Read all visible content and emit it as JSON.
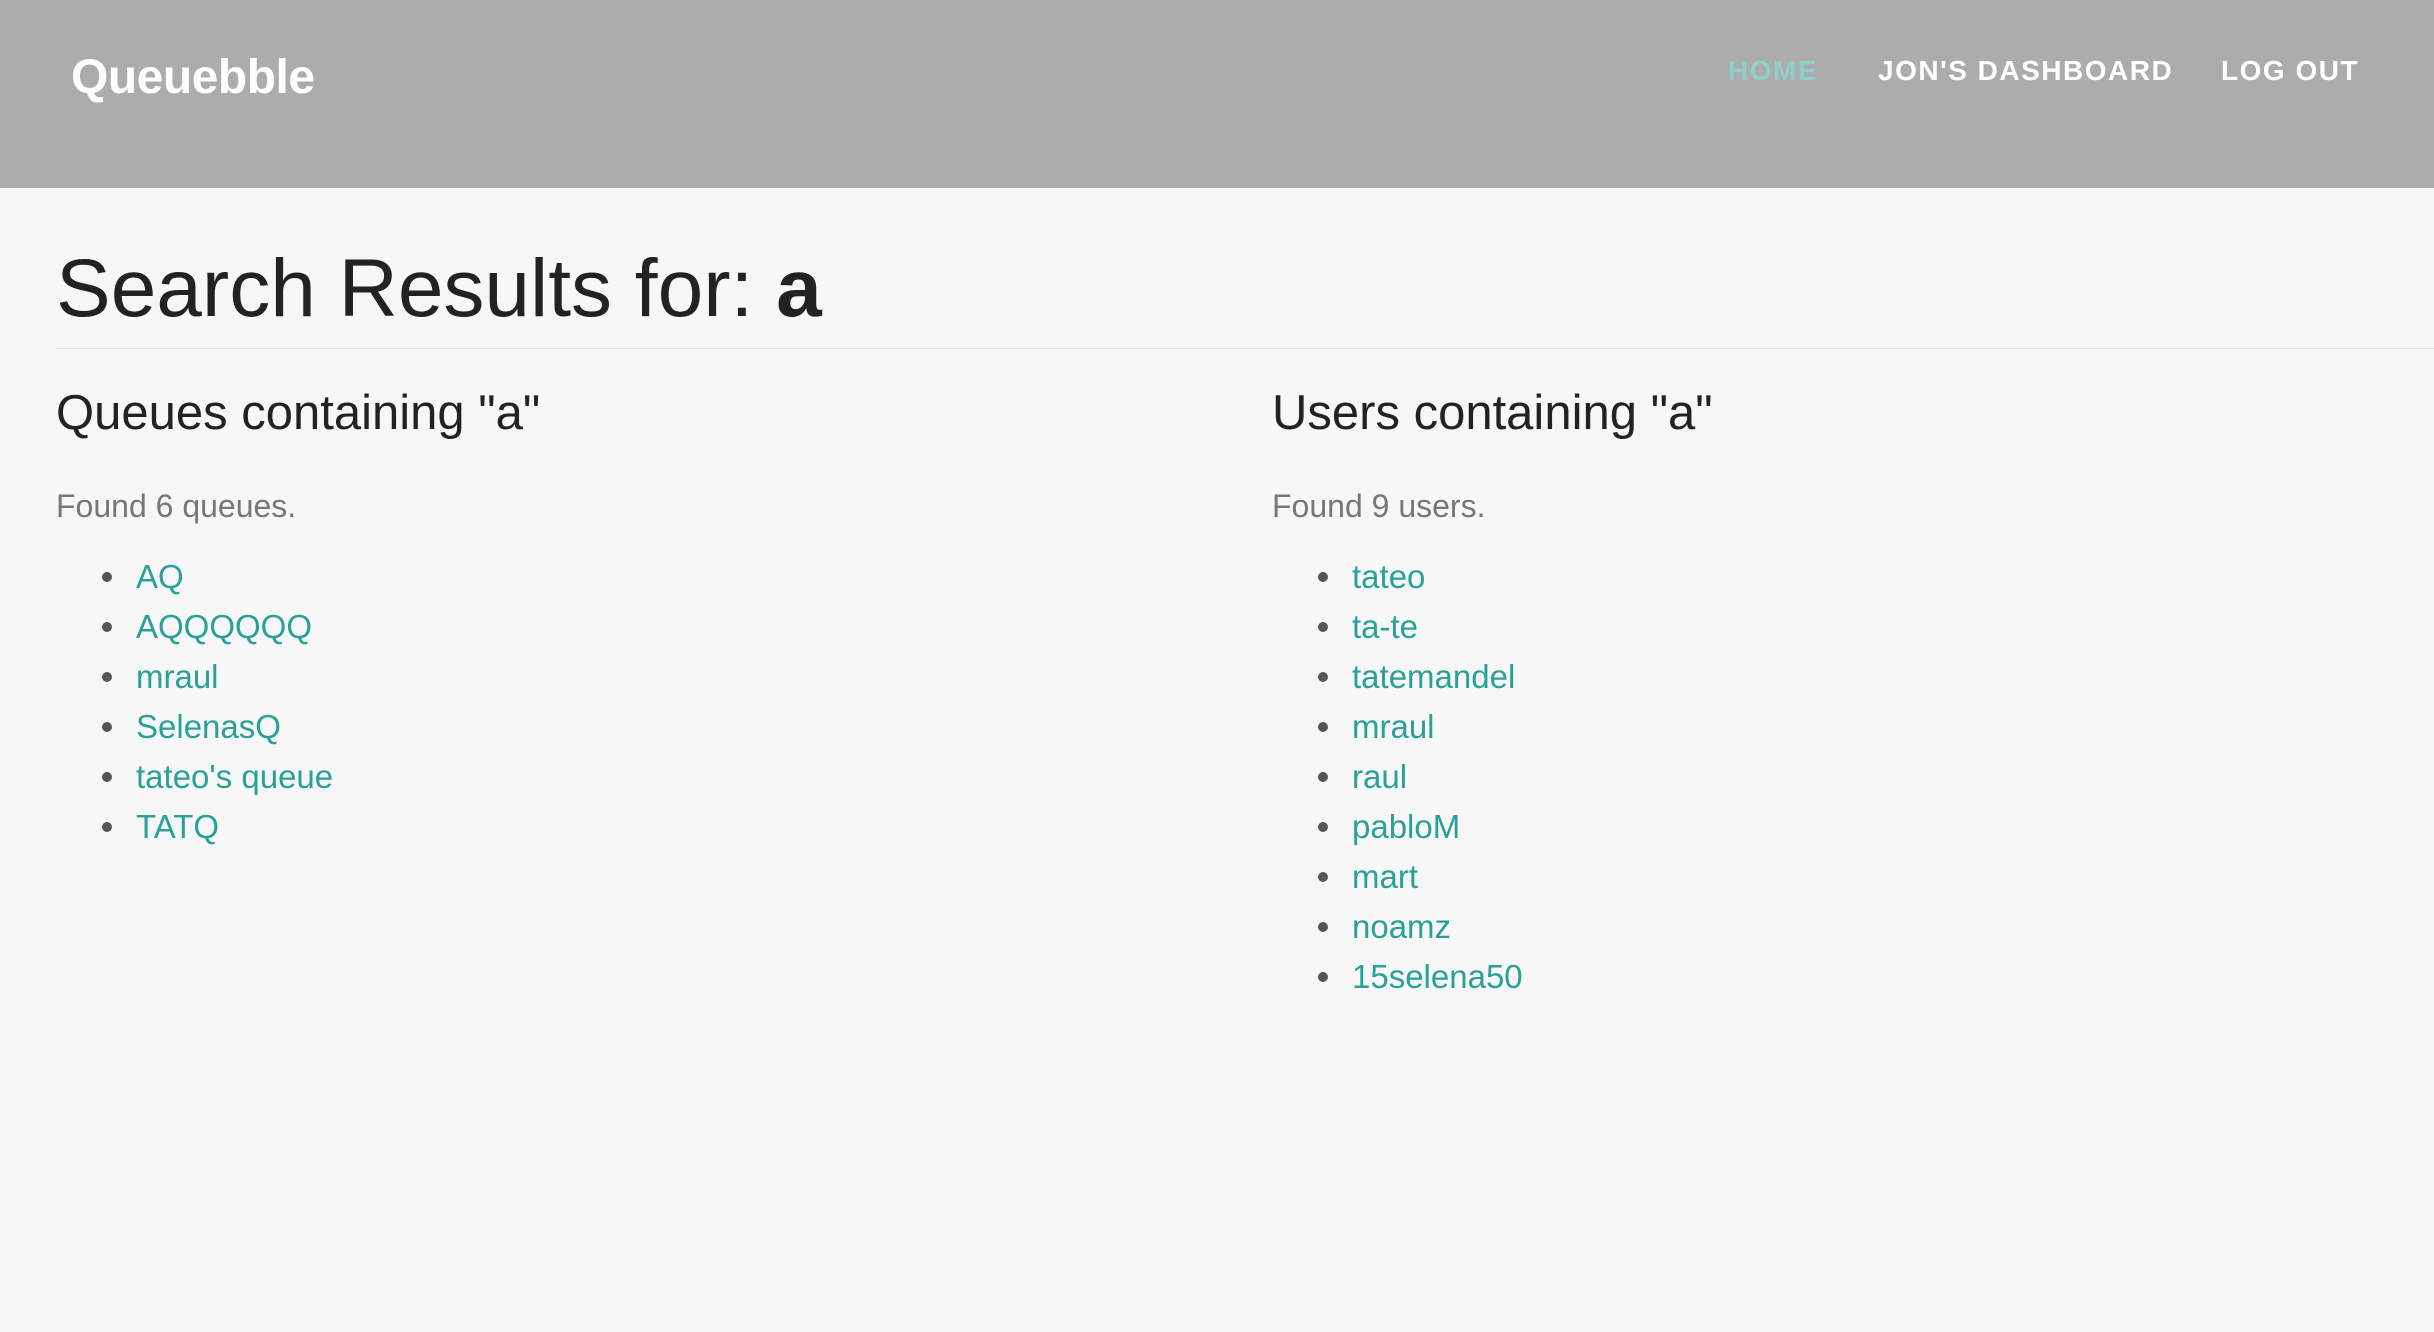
{
  "navbar": {
    "brand": "Queuebble",
    "links": [
      {
        "label": "HOME",
        "active": true
      },
      {
        "label": "JON'S DASHBOARD",
        "active": false
      },
      {
        "label": "LOG OUT",
        "active": false
      }
    ]
  },
  "page": {
    "title_prefix": "Search Results for: ",
    "query": "a"
  },
  "queues": {
    "heading": "Queues containing \"a\"",
    "found_text": "Found 6 queues.",
    "items": [
      "AQ",
      "AQQQQQQ",
      "mraul",
      "SelenasQ",
      "tateo's queue",
      "TATQ"
    ]
  },
  "users": {
    "heading": "Users containing \"a\"",
    "found_text": "Found 9 users.",
    "items": [
      "tateo",
      "ta-te",
      "tatemandel",
      "mraul",
      "raul",
      "pabloM",
      "mart",
      "noamz",
      "15selena50"
    ]
  },
  "colors": {
    "navbar_bg": "#acacac",
    "page_bg": "#f7f7f7",
    "link": "#2aa198",
    "active_nav": "#8ecfc9"
  }
}
